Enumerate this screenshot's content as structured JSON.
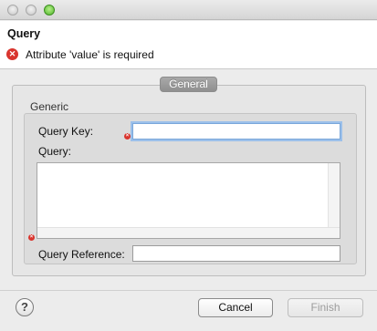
{
  "window": {
    "title": ""
  },
  "header": {
    "title": "Query",
    "error_message": "Attribute 'value' is required",
    "error_icon": "error-circle-icon"
  },
  "tabs": [
    {
      "label": "General",
      "selected": true
    }
  ],
  "section": {
    "label": "Generic",
    "fields": {
      "query_key": {
        "label": "Query Key:",
        "value": ""
      },
      "query": {
        "label": "Query:",
        "value": ""
      },
      "query_reference": {
        "label": "Query Reference:",
        "value": ""
      }
    }
  },
  "footer": {
    "help_glyph": "?",
    "cancel_label": "Cancel",
    "finish_label": "Finish"
  },
  "colors": {
    "error": "#d9352e",
    "focus": "#7aa7da",
    "tab_bg": "#9b9b9b"
  }
}
